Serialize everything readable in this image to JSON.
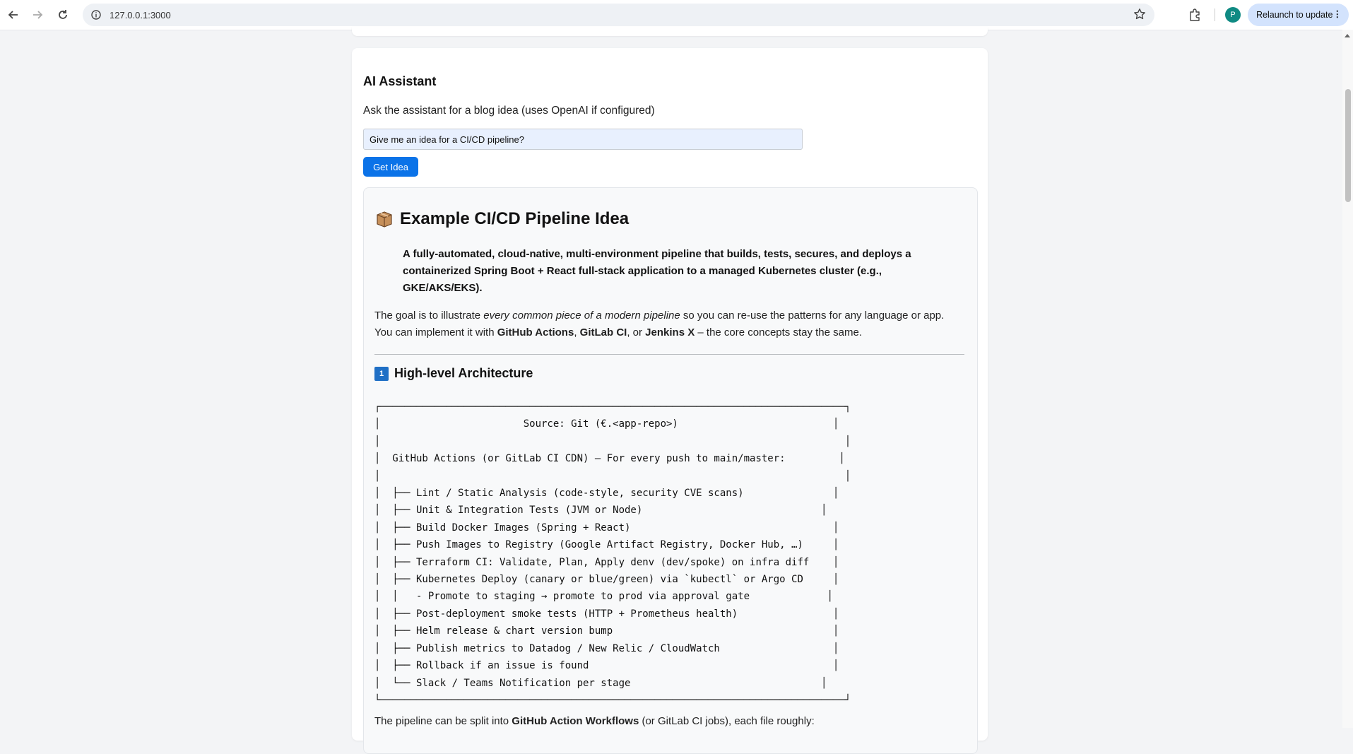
{
  "browser": {
    "url": "127.0.0.1:3000",
    "profile_initial": "P",
    "relaunch_label": "Relaunch to update"
  },
  "assistant": {
    "title": "AI Assistant",
    "description": "Ask the assistant for a blog idea (uses OpenAI if configured)",
    "prompt_value": "Give me an idea for a CI/CD pipeline?",
    "button_label": "Get Idea"
  },
  "result": {
    "heading": "Example CI/CD Pipeline Idea",
    "heading_icon": "package-icon",
    "quote": "A fully-automated, cloud-native, multi-environment pipeline that builds, tests, secures, and deploys a containerized Spring Boot + React full-stack application to a managed Kubernetes cluster (e.g., GKE/AKS/EKS).",
    "intro": {
      "p1_before": "The goal is to illustrate ",
      "p1_em": "every common piece of a modern pipeline",
      "p1_after": " so you can re-use the patterns for any language or app.",
      "p2_before": "You can implement it with ",
      "p2_b1": "GitHub Actions",
      "p2_sep1": ", ",
      "p2_b2": "GitLab CI",
      "p2_sep2": ", or ",
      "p2_b3": "Jenkins X",
      "p2_after": " – the core concepts stay the same."
    },
    "section1_number": "1",
    "section1_title": "High-level Architecture",
    "diagram": "┌──────────────────────────────────────────────────────────────────────────────┐\n│                        Source: Git (€.<app-repo>)                          │\n│                                                                              │\n│  GitHub Actions (or GitLab CI CDN) – For every push to main/master:         │\n│                                                                              │\n│  ├── Lint / Static Analysis (code-style, security CVE scans)               │\n│  ├── Unit & Integration Tests (JVM or Node)                              │\n│  ├── Build Docker Images (Spring + React)                                  │\n│  ├── Push Images to Registry (Google Artifact Registry, Docker Hub, …)     │\n│  ├── Terraform CI: Validate, Plan, Apply denv (dev/spoke) on infra diff    │\n│  ├── Kubernetes Deploy (canary or blue/green) via `kubectl` or Argo CD     │\n│  │   - Promote to staging → promote to prod via approval gate             │\n│  ├── Post-deployment smoke tests (HTTP + Prometheus health)                │\n│  ├── Helm release & chart version bump                                     │\n│  ├── Publish metrics to Datadog / New Relic / CloudWatch                   │\n│  ├── Rollback if an issue is found                                         │\n│  └── Slack / Teams Notification per stage                                │\n└──────────────────────────────────────────────────────────────────────────────┘",
    "after_before": "The pipeline can be split into ",
    "after_bold": "GitHub Action Workflows",
    "after_after": " (or GitLab CI jobs), each file roughly:"
  }
}
